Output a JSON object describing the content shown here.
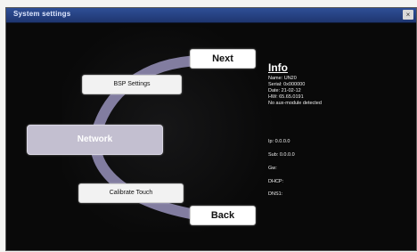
{
  "window": {
    "title": "System settings",
    "close_glyph": "×"
  },
  "menu": {
    "next": "Next",
    "bsp_settings": "BSP Settings",
    "network": "Network",
    "calibrate_touch": "Calibrate Touch",
    "back": "Back"
  },
  "info": {
    "title": "Info",
    "name": "Name: UN20",
    "serial": "Serial: 0x000000",
    "date": "Date: 21-02-12",
    "hw": "HW: 65.65.0191",
    "aux": "No aux-module detected"
  },
  "network": {
    "ip": "Ip: 0.0.0.0",
    "sub": "Sub: 0.0.0.0",
    "gw": "Gw:",
    "dhcp": "DHCP:",
    "dns": "DNS1:"
  },
  "colors": {
    "background": "#090909",
    "titlebar": "#2f4f96",
    "arc": "#8f8ab0",
    "network_button": "#c3bfd0"
  }
}
